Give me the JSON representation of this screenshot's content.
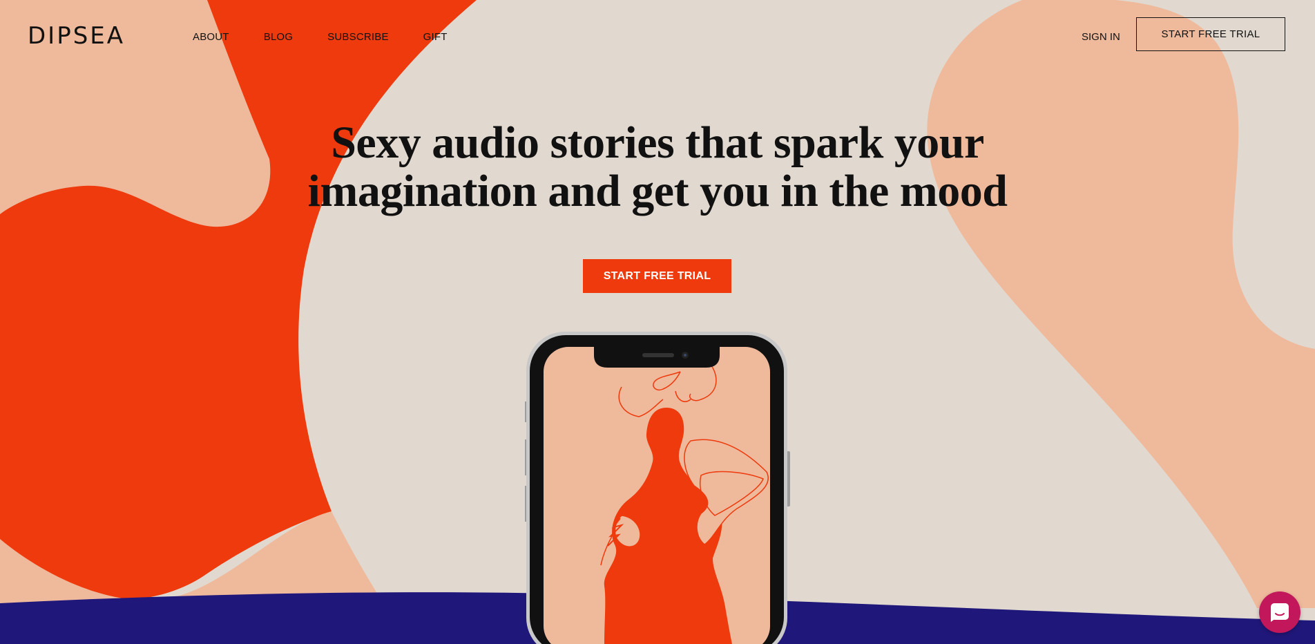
{
  "brand": {
    "logo_text": "DIPSEA"
  },
  "nav": {
    "items": [
      {
        "label": "ABOUT"
      },
      {
        "label": "BLOG"
      },
      {
        "label": "SUBSCRIBE"
      },
      {
        "label": "GIFT"
      }
    ],
    "sign_in_label": "SIGN IN",
    "trial_label": "START FREE TRIAL"
  },
  "hero": {
    "headline_line1": "Sexy audio stories that spark your",
    "headline_line2": "imagination and get you in the mood",
    "cta_label": "START FREE TRIAL"
  },
  "chat": {
    "icon": "chat-bubble-icon"
  },
  "colors": {
    "background": "#e1d9cf",
    "orange": "#ee3a0c",
    "peach": "#efb99c",
    "navy": "#20177a",
    "chat": "#c2185b",
    "text": "#111111"
  }
}
